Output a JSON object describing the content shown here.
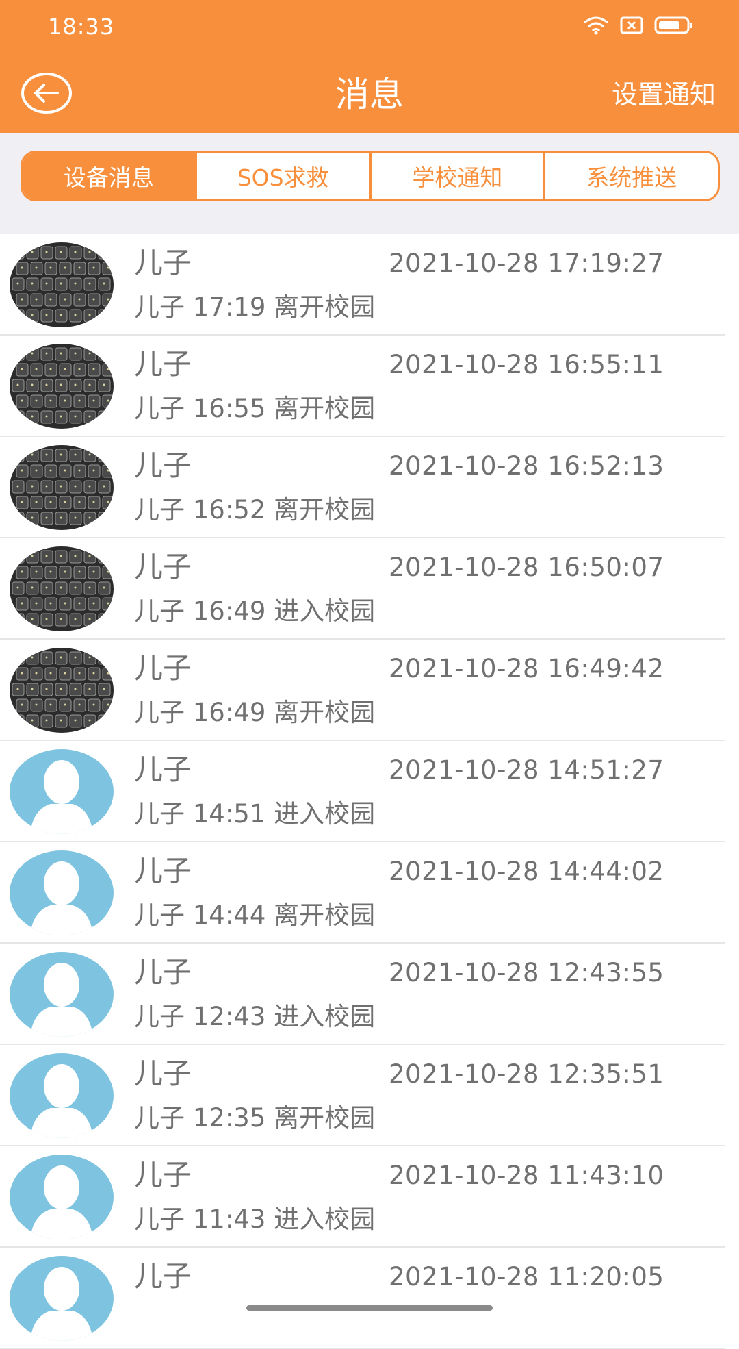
{
  "status_bar": {
    "time": "18:33",
    "icons": [
      "wifi-icon",
      "sim-card-x-icon",
      "battery-icon"
    ]
  },
  "header": {
    "title": "消息",
    "back_icon": "arrow-left-circle-icon",
    "settings_label": "设置通知",
    "color": "#F78F3C"
  },
  "tabs": [
    {
      "label": "设备消息",
      "active": true
    },
    {
      "label": "SOS求救",
      "active": false
    },
    {
      "label": "学校通知",
      "active": false
    },
    {
      "label": "系统推送",
      "active": false
    }
  ],
  "messages": [
    {
      "sender": "儿子",
      "time": "2021-10-28 17:19:27",
      "text": "儿子 17:19 离开校园",
      "avatar": "keyboard-photo"
    },
    {
      "sender": "儿子",
      "time": "2021-10-28 16:55:11",
      "text": "儿子 16:55 离开校园",
      "avatar": "keyboard-photo"
    },
    {
      "sender": "儿子",
      "time": "2021-10-28 16:52:13",
      "text": "儿子 16:52 离开校园",
      "avatar": "keyboard-photo"
    },
    {
      "sender": "儿子",
      "time": "2021-10-28 16:50:07",
      "text": "儿子 16:49 进入校园",
      "avatar": "keyboard-photo"
    },
    {
      "sender": "儿子",
      "time": "2021-10-28 16:49:42",
      "text": "儿子 16:49 离开校园",
      "avatar": "keyboard-photo"
    },
    {
      "sender": "儿子",
      "time": "2021-10-28 14:51:27",
      "text": "儿子 14:51 进入校园",
      "avatar": "default-person"
    },
    {
      "sender": "儿子",
      "time": "2021-10-28 14:44:02",
      "text": "儿子 14:44 离开校园",
      "avatar": "default-person"
    },
    {
      "sender": "儿子",
      "time": "2021-10-28 12:43:55",
      "text": "儿子 12:43 进入校园",
      "avatar": "default-person"
    },
    {
      "sender": "儿子",
      "time": "2021-10-28 12:35:51",
      "text": "儿子 12:35 离开校园",
      "avatar": "default-person"
    },
    {
      "sender": "儿子",
      "time": "2021-10-28 11:43:10",
      "text": "儿子 11:43 进入校园",
      "avatar": "default-person"
    },
    {
      "sender": "儿子",
      "time": "2021-10-28 11:20:05",
      "text": "",
      "avatar": "default-person"
    }
  ]
}
